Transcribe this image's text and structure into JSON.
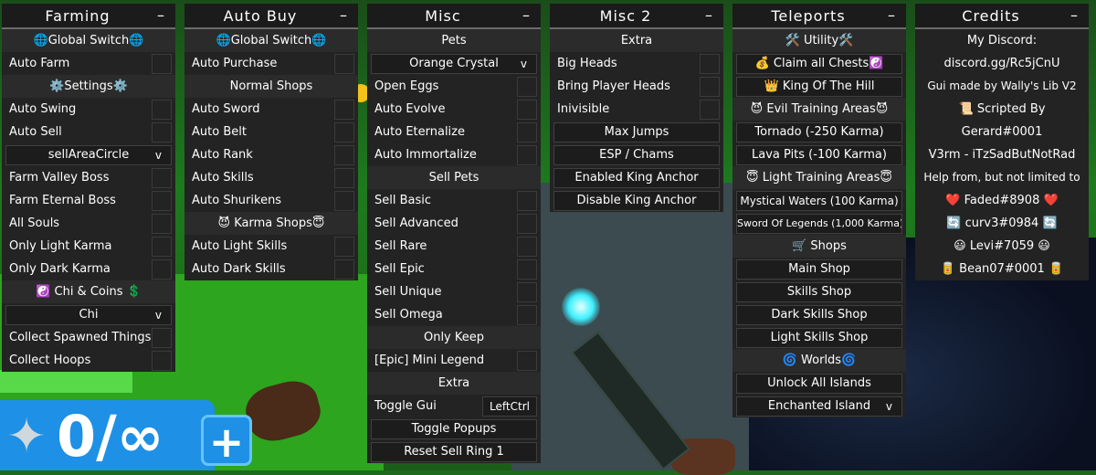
{
  "panels": {
    "farming": {
      "title": "Farming",
      "min": "–",
      "global_switch": "Global Switch",
      "auto_farm": "Auto Farm",
      "settings": "Settings",
      "auto_swing": "Auto Swing",
      "auto_sell": "Auto Sell",
      "sell_area_dropdown": "sellAreaCircle",
      "farm_valley_boss": "Farm Valley Boss",
      "farm_eternal_boss": "Farm Eternal Boss",
      "all_souls": "All Souls",
      "only_light_karma": "Only Light Karma",
      "only_dark_karma": "Only Dark Karma",
      "chi_coins": "Chi & Coins",
      "chi_dropdown": "Chi",
      "collect_spawned": "Collect Spawned Things",
      "collect_hoops": "Collect Hoops"
    },
    "auto_buy": {
      "title": "Auto Buy",
      "min": "–",
      "global_switch": "Global Switch",
      "auto_purchase": "Auto Purchase",
      "normal_shops": "Normal Shops",
      "auto_sword": "Auto Sword",
      "auto_belt": "Auto Belt",
      "auto_rank": "Auto Rank",
      "auto_skills": "Auto Skills",
      "auto_shurikens": "Auto Shurikens",
      "karma_shops": "Karma Shops",
      "auto_light_skills": "Auto Light Skills",
      "auto_dark_skills": "Auto Dark Skills"
    },
    "misc": {
      "title": "Misc",
      "min": "–",
      "pets": "Pets",
      "pet_dropdown": "Orange Crystal",
      "open_eggs": "Open Eggs",
      "auto_evolve": "Auto Evolve",
      "auto_eternalize": "Auto Eternalize",
      "auto_immortalize": "Auto Immortalize",
      "sell_pets": "Sell Pets",
      "sell_basic": "Sell Basic",
      "sell_advanced": "Sell Advanced",
      "sell_rare": "Sell Rare",
      "sell_epic": "Sell Epic",
      "sell_unique": "Sell Unique",
      "sell_omega": "Sell Omega",
      "only_keep": "Only Keep",
      "epic_mini_legend": "[Epic] Mini Legend",
      "extra": "Extra",
      "toggle_gui": "Toggle Gui",
      "toggle_gui_key": "LeftCtrl",
      "toggle_popups": "Toggle Popups",
      "reset_sell_ring": "Reset Sell Ring 1"
    },
    "misc2": {
      "title": "Misc 2",
      "min": "–",
      "extra": "Extra",
      "big_heads": "Big Heads",
      "bring_player_heads": "Bring Player Heads",
      "invisible": "Inivisible",
      "max_jumps": "Max Jumps",
      "esp_chams": "ESP / Chams",
      "enable_king_anchor": "Enabled King Anchor",
      "disable_king_anchor": "Disable King Anchor"
    },
    "teleports": {
      "title": "Teleports",
      "min": "–",
      "utility": "Utility",
      "claim_chests": "Claim all Chests",
      "king_of_hill": "King Of The Hill",
      "evil_training": "Evil Training Areas",
      "tornado": "Tornado (-250 Karma)",
      "lava_pits": "Lava Pits (-100 Karma)",
      "light_training": "Light Training Areas",
      "mystical_waters": "Mystical Waters (100 Karma)",
      "sword_of_legends": "Sword Of Legends (1,000 Karma)",
      "shops": "Shops",
      "main_shop": "Main Shop",
      "skills_shop": "Skills Shop",
      "dark_skills_shop": "Dark Skills Shop",
      "light_skills_shop": "Light Skills Shop",
      "worlds": "Worlds",
      "unlock_islands": "Unlock All Islands",
      "island_dropdown": "Enchanted Island"
    },
    "credits": {
      "title": "Credits",
      "min": "–",
      "my_discord": "My Discord:",
      "discord_link": "discord.gg/Rc5jCnU",
      "gui_made_by": "Gui made by Wally's Lib V2",
      "scripted_by": "Scripted By",
      "gerard": "Gerard#0001",
      "v3rm": "V3rm - iTzSadButNotRad",
      "help_from": "Help from, but not limited to",
      "faded": "Faded#8908",
      "curv3": "curv3#0984",
      "levi": "Levi#7059",
      "bean": "Bean07#0001"
    }
  },
  "hud": {
    "count": "0/∞",
    "plus": "+"
  },
  "dropdown_arrow": "v",
  "colors": {
    "panel_bg": "#232323",
    "header_bg": "#1b1b1b",
    "section_bg": "#2b2b2b",
    "hud_blue": "#1e90e6"
  }
}
